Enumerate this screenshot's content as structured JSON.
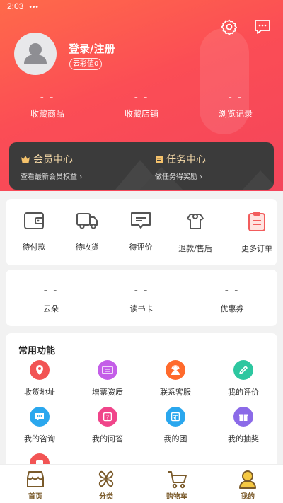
{
  "status_bar": {
    "time": "2:03",
    "dots": "•••"
  },
  "profile": {
    "login_label": "登录/注册",
    "badge": "云彩值0"
  },
  "stats": [
    {
      "value": "- -",
      "label": "收藏商品"
    },
    {
      "value": "- -",
      "label": "收藏店铺"
    },
    {
      "value": "- -",
      "label": "浏览记录"
    }
  ],
  "member": {
    "vip_title": "会员中心",
    "vip_sub": "查看最新会员权益",
    "task_title": "任务中心",
    "task_sub": "做任务得奖励"
  },
  "orders": [
    {
      "label": "待付款",
      "icon": "wallet-icon"
    },
    {
      "label": "待收货",
      "icon": "truck-icon"
    },
    {
      "label": "待评价",
      "icon": "comment-icon"
    },
    {
      "label": "退款/售后",
      "icon": "refund-icon"
    },
    {
      "label": "更多订单",
      "icon": "clipboard-icon"
    }
  ],
  "wallet": [
    {
      "value": "- -",
      "label": "云朵"
    },
    {
      "value": "- -",
      "label": "读书卡"
    },
    {
      "value": "- -",
      "label": "优惠券"
    }
  ],
  "functions": {
    "title": "常用功能",
    "items": [
      {
        "label": "收货地址",
        "icon": "location-icon",
        "color": "#f25454"
      },
      {
        "label": "增票资质",
        "icon": "ticket-icon",
        "color": "#c45ee8"
      },
      {
        "label": "联系客服",
        "icon": "service-icon",
        "color": "#ff6a2c"
      },
      {
        "label": "我的评价",
        "icon": "pencil-icon",
        "color": "#2dc7a0"
      },
      {
        "label": "我的咨询",
        "icon": "chat-icon",
        "color": "#2aa7ee"
      },
      {
        "label": "我的问答",
        "icon": "qa-icon",
        "color": "#f0458a"
      },
      {
        "label": "我的团",
        "icon": "group-icon",
        "color": "#2aa7ee"
      },
      {
        "label": "我的抽奖",
        "icon": "gift-icon",
        "color": "#8b6ae8"
      }
    ]
  },
  "tabs": [
    {
      "label": "首页",
      "icon": "home-icon"
    },
    {
      "label": "分类",
      "icon": "category-icon"
    },
    {
      "label": "购物车",
      "icon": "cart-icon"
    },
    {
      "label": "我的",
      "icon": "profile-icon",
      "active": true
    }
  ]
}
